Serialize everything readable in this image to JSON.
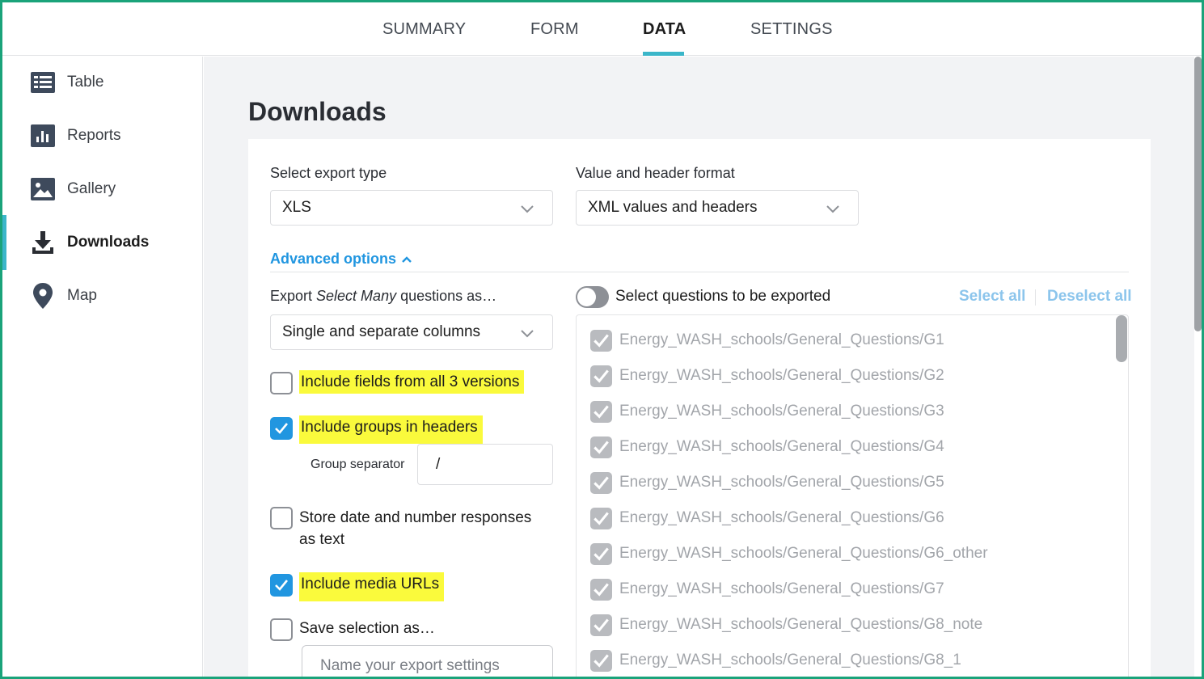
{
  "tabs": [
    {
      "label": "SUMMARY",
      "active": false
    },
    {
      "label": "FORM",
      "active": false
    },
    {
      "label": "DATA",
      "active": true
    },
    {
      "label": "SETTINGS",
      "active": false
    }
  ],
  "sidebar": {
    "items": [
      {
        "label": "Table",
        "icon": "table-icon",
        "active": false
      },
      {
        "label": "Reports",
        "icon": "bar-chart-icon",
        "active": false
      },
      {
        "label": "Gallery",
        "icon": "image-icon",
        "active": false
      },
      {
        "label": "Downloads",
        "icon": "download-icon",
        "active": true
      },
      {
        "label": "Map",
        "icon": "map-pin-icon",
        "active": false
      }
    ]
  },
  "page": {
    "title": "Downloads"
  },
  "export_type": {
    "label": "Select export type",
    "value": "XLS"
  },
  "header_format": {
    "label": "Value and header format",
    "value": "XML values and headers"
  },
  "advanced": {
    "label": "Advanced options",
    "expanded": true
  },
  "select_many": {
    "label_prefix": "Export ",
    "label_em": "Select Many",
    "label_suffix": " questions as…",
    "value": "Single and separate columns"
  },
  "options": {
    "all_versions": {
      "label": "Include fields from all 3 versions",
      "checked": false
    },
    "groups_headers": {
      "label": "Include groups in headers",
      "checked": true
    },
    "group_separator": {
      "label": "Group separator",
      "value": "/"
    },
    "store_text": {
      "label": "Store date and number responses as text",
      "checked": false
    },
    "media_urls": {
      "label": "Include media URLs",
      "checked": true
    },
    "save_selection": {
      "label": "Save selection as…",
      "checked": false
    },
    "name_placeholder": "Name your export settings"
  },
  "questions": {
    "toggle_label": "Select questions to be exported",
    "toggle_on": false,
    "select_all": "Select all",
    "deselect_all": "Deselect all",
    "items": [
      "Energy_WASH_schools/General_Questions/G1",
      "Energy_WASH_schools/General_Questions/G2",
      "Energy_WASH_schools/General_Questions/G3",
      "Energy_WASH_schools/General_Questions/G4",
      "Energy_WASH_schools/General_Questions/G5",
      "Energy_WASH_schools/General_Questions/G6",
      "Energy_WASH_schools/General_Questions/G6_other",
      "Energy_WASH_schools/General_Questions/G7",
      "Energy_WASH_schools/General_Questions/G8_note",
      "Energy_WASH_schools/General_Questions/G8_1"
    ]
  },
  "colors": {
    "accent": "#3bb6c9",
    "link": "#2196e0",
    "highlight": "#fafa3c",
    "frame": "#1aa37a"
  }
}
